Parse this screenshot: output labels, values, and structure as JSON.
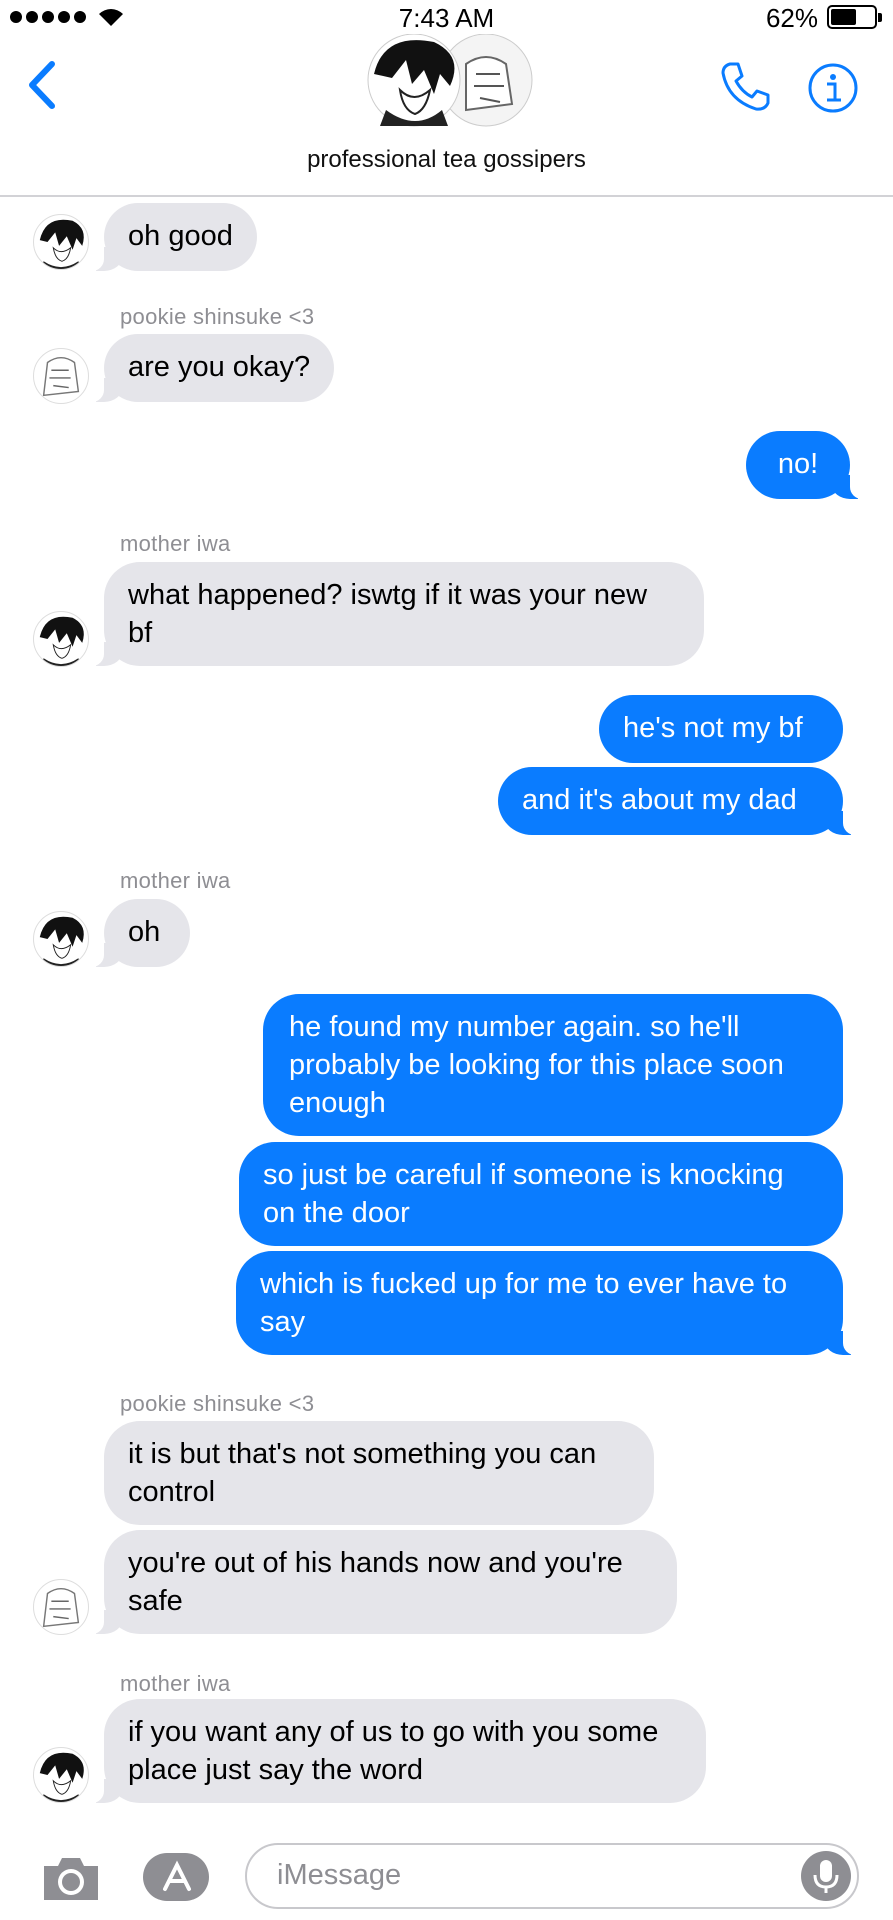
{
  "status_bar": {
    "time": "7:43 AM",
    "battery_percent": "62%",
    "battery_level": 0.62
  },
  "header": {
    "group_name": "professional tea gossipers"
  },
  "colors": {
    "outgoing_bubble": "#0a7cff",
    "incoming_bubble": "#e5e5ea",
    "accent": "#0a7cff"
  },
  "messages": [
    {
      "dir": "in",
      "text": "oh good",
      "avatar": "iwa"
    },
    {
      "sender": "pookie shinsuke <3"
    },
    {
      "dir": "in",
      "text": "are you okay?",
      "avatar": "shinsuke"
    },
    {
      "dir": "out",
      "text": "no!"
    },
    {
      "sender": "mother iwa"
    },
    {
      "dir": "in",
      "text": "what happened? iswtg if it was your new\nbf",
      "avatar": "iwa"
    },
    {
      "dir": "out",
      "text": "he's not my bf"
    },
    {
      "dir": "out",
      "text": "and it's about my dad"
    },
    {
      "sender": "mother iwa"
    },
    {
      "dir": "in",
      "text": "oh",
      "avatar": "iwa"
    },
    {
      "dir": "out",
      "text": "he found my number again. so he'll\nprobably be looking for this place soon\nenough"
    },
    {
      "dir": "out",
      "text": "so just be careful if someone is knocking\non the door"
    },
    {
      "dir": "out",
      "text": "which is fucked up for me to ever have to\nsay"
    },
    {
      "sender": "pookie shinsuke <3"
    },
    {
      "dir": "in",
      "text": "it is but that's not something you can\ncontrol"
    },
    {
      "dir": "in",
      "text": "you're out of his hands now and you're\nsafe",
      "avatar": "shinsuke"
    },
    {
      "sender": "mother iwa"
    },
    {
      "dir": "in",
      "text": "if you want any of us to go with you some\nplace just say the word",
      "avatar": "iwa"
    }
  ],
  "input": {
    "placeholder": "iMessage"
  },
  "icons": [
    "back-chevron-icon",
    "phone-icon",
    "info-icon",
    "camera-icon",
    "app-store-icon",
    "microphone-icon",
    "wifi-icon"
  ]
}
